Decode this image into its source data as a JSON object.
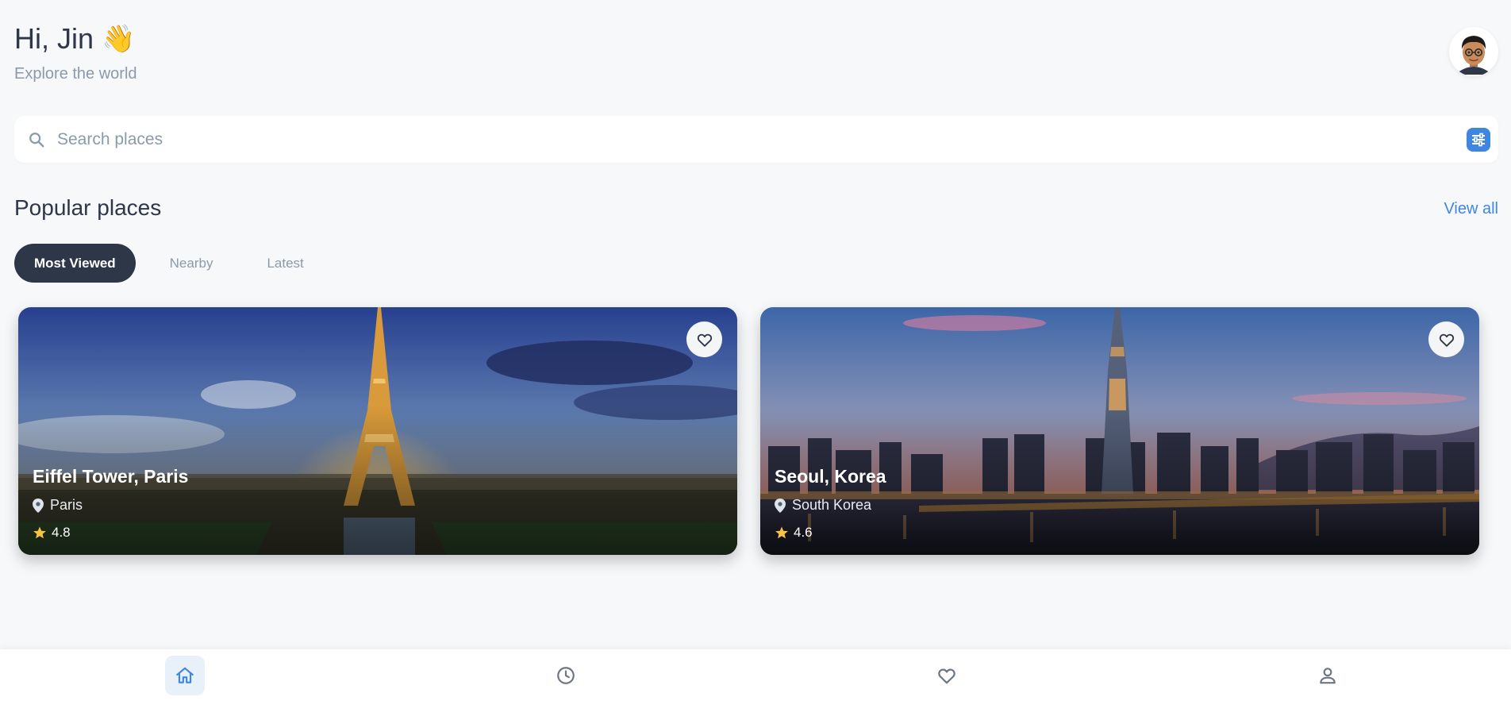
{
  "header": {
    "greeting": "Hi, Jin",
    "wave_emoji": "👋",
    "subtitle": "Explore the world"
  },
  "search": {
    "placeholder": "Search places",
    "value": ""
  },
  "section": {
    "title": "Popular places",
    "view_all": "View all"
  },
  "tabs": [
    {
      "label": "Most Viewed",
      "active": true
    },
    {
      "label": "Nearby",
      "active": false
    },
    {
      "label": "Latest",
      "active": false
    }
  ],
  "places": [
    {
      "title": "Eiffel Tower, Paris",
      "location": "Paris",
      "rating": "4.8"
    },
    {
      "title": "Seoul, Korea",
      "location": "South Korea",
      "rating": "4.6"
    }
  ],
  "bottom_nav": [
    {
      "icon": "home-icon",
      "active": true
    },
    {
      "icon": "clock-icon",
      "active": false
    },
    {
      "icon": "heart-icon",
      "active": false
    },
    {
      "icon": "user-icon",
      "active": false
    }
  ],
  "colors": {
    "accent": "#3f86e0",
    "dark": "#2d3748",
    "muted": "#8a9aab",
    "star": "#f6c343",
    "background": "#f6f8fa"
  }
}
